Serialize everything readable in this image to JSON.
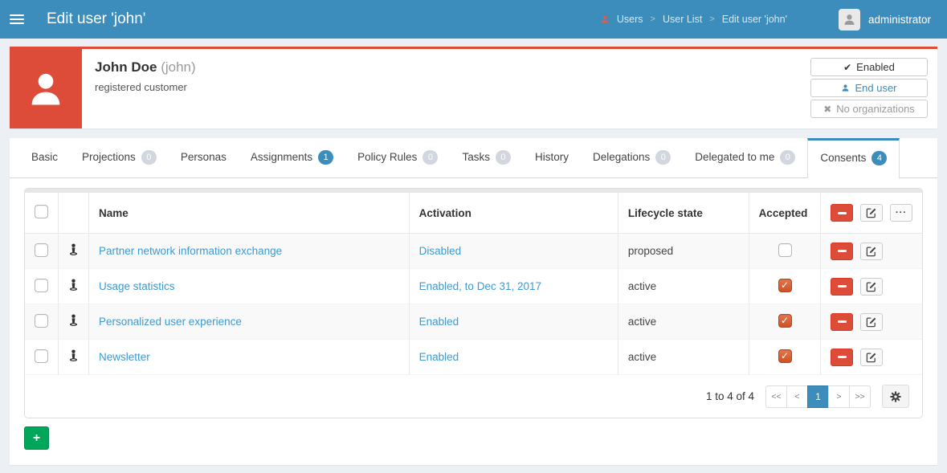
{
  "header": {
    "title": "Edit user 'john'",
    "breadcrumb": {
      "separator": ">",
      "items": [
        "Users",
        "User List",
        "Edit user 'john'"
      ]
    },
    "account_name": "administrator"
  },
  "summary": {
    "display_name": "John Doe",
    "username": "(john)",
    "description": "registered customer",
    "tags": [
      {
        "icon": "check-icon",
        "label": "Enabled"
      },
      {
        "icon": "user-icon",
        "label": "End user"
      },
      {
        "icon": "x-icon",
        "label": "No organizations"
      }
    ]
  },
  "tabs": [
    {
      "label": "Basic"
    },
    {
      "label": "Projections",
      "count": "0"
    },
    {
      "label": "Personas"
    },
    {
      "label": "Assignments",
      "count": "1"
    },
    {
      "label": "Policy Rules",
      "count": "0"
    },
    {
      "label": "Tasks",
      "count": "0"
    },
    {
      "label": "History"
    },
    {
      "label": "Delegations",
      "count": "0"
    },
    {
      "label": "Delegated to me",
      "count": "0"
    },
    {
      "label": "Consents",
      "count": "4",
      "active": true
    }
  ],
  "table": {
    "columns": [
      "Name",
      "Activation",
      "Lifecycle state",
      "Accepted"
    ],
    "rows": [
      {
        "name": "Partner network information exchange",
        "activation": "Disabled",
        "lifecycle": "proposed",
        "accepted": false
      },
      {
        "name": "Usage statistics",
        "activation": "Enabled, to Dec 31, 2017",
        "lifecycle": "active",
        "accepted": true
      },
      {
        "name": "Personalized user experience",
        "activation": "Enabled",
        "lifecycle": "active",
        "accepted": true
      },
      {
        "name": "Newsletter",
        "activation": "Enabled",
        "lifecycle": "active",
        "accepted": true
      }
    ]
  },
  "pagination": {
    "summary": "1 to 4 of 4",
    "first": "<<",
    "prev": "<",
    "page": "1",
    "next": ">",
    "last": ">>"
  },
  "icons": {
    "check": "✔",
    "cross": "✖",
    "more": "···",
    "plus": "+"
  },
  "colors": {
    "header_bg": "#3c8dbc",
    "accent_red": "#dd4b39",
    "accent_green": "#00a65a",
    "link_blue": "#3d9ad1",
    "badge_gray": "#d2d6de",
    "badge_blue": "#3c8dbc",
    "checked_checkbox": "#d95b2e",
    "page_bg": "#ecf0f5"
  }
}
